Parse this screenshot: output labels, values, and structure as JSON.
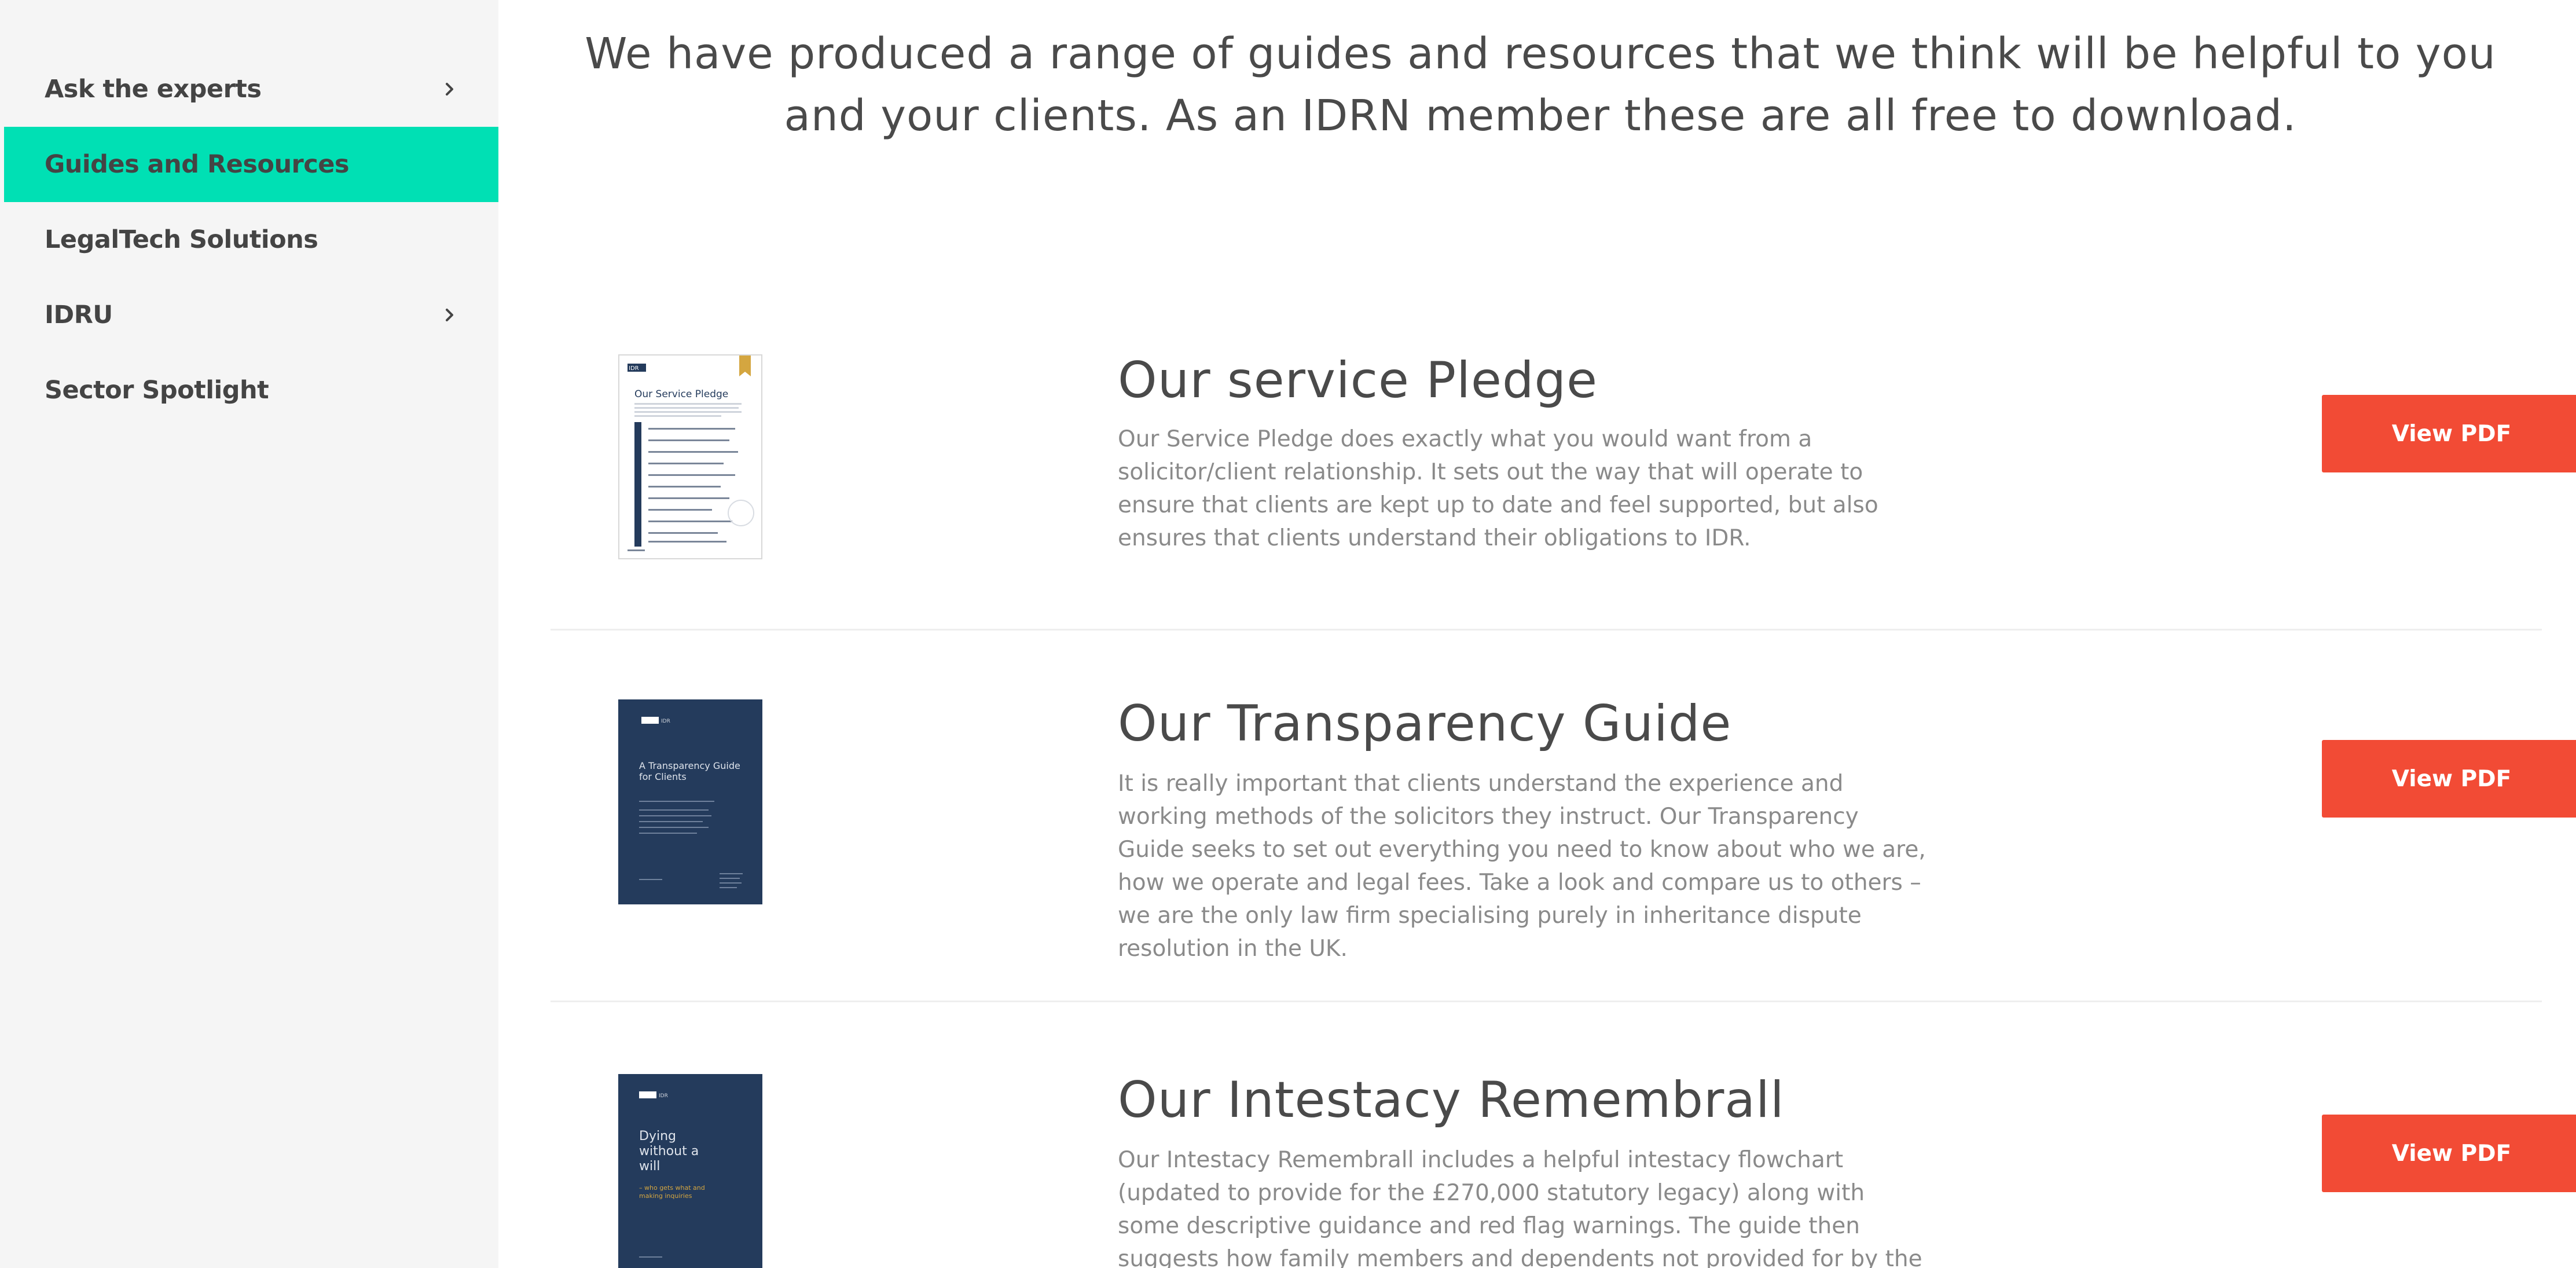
{
  "sidebar": {
    "items": [
      {
        "label": "Ask the experts",
        "has_chevron": true,
        "active": false
      },
      {
        "label": "Guides and Resources",
        "has_chevron": false,
        "active": true
      },
      {
        "label": "LegalTech Solutions",
        "has_chevron": false,
        "active": false
      },
      {
        "label": "IDRU",
        "has_chevron": true,
        "active": false
      },
      {
        "label": "Sector Spotlight",
        "has_chevron": false,
        "active": false
      }
    ]
  },
  "intro": {
    "text": "We have produced a range of guides and resources that we think will be helpful to you and your clients. As an IDRN member these are all free to download."
  },
  "resources": [
    {
      "title": "Our service Pledge",
      "description": "Our Service Pledge does exactly what you would want from a solicitor/client relationship. It sets out the way that will operate to ensure that clients are kept up to date and feel supported, but also ensures that clients understand their obligations to IDR.",
      "button_label": "View PDF",
      "thumb": {
        "style": "light",
        "logo": "IDR",
        "heading": "Our Service Pledge"
      }
    },
    {
      "title": "Our Transparency Guide",
      "description": "It is really important that clients understand the experience and working methods of the solicitors they instruct. Our Transparency Guide seeks to set out everything you need to know about who we are, how we operate and legal fees. Take a look and compare us to others – we are the only law firm specialising purely in inheritance dispute resolution in the UK.",
      "button_label": "View PDF",
      "thumb": {
        "style": "dark",
        "logo": "IDR",
        "heading": "A Transparency Guide for Clients"
      }
    },
    {
      "title": "Our Intestacy Remembrall",
      "description": "Our Intestacy Remembrall includes a helpful intestacy flowchart (updated to provide for the £270,000 statutory legacy) along with some descriptive guidance and red flag warnings. The guide then suggests how family members and dependents not provided for by the intestacy",
      "button_label": "View PDF",
      "thumb": {
        "style": "dark",
        "logo": "IDR",
        "heading": "Dying without a will",
        "subheading": "– who gets what and making inquiries"
      }
    }
  ],
  "colors": {
    "sidebar_bg": "#f5f5f5",
    "active_item": "#00e0b4",
    "button": "#f24b35",
    "navy": "#243b5c",
    "gold": "#d4a640"
  }
}
